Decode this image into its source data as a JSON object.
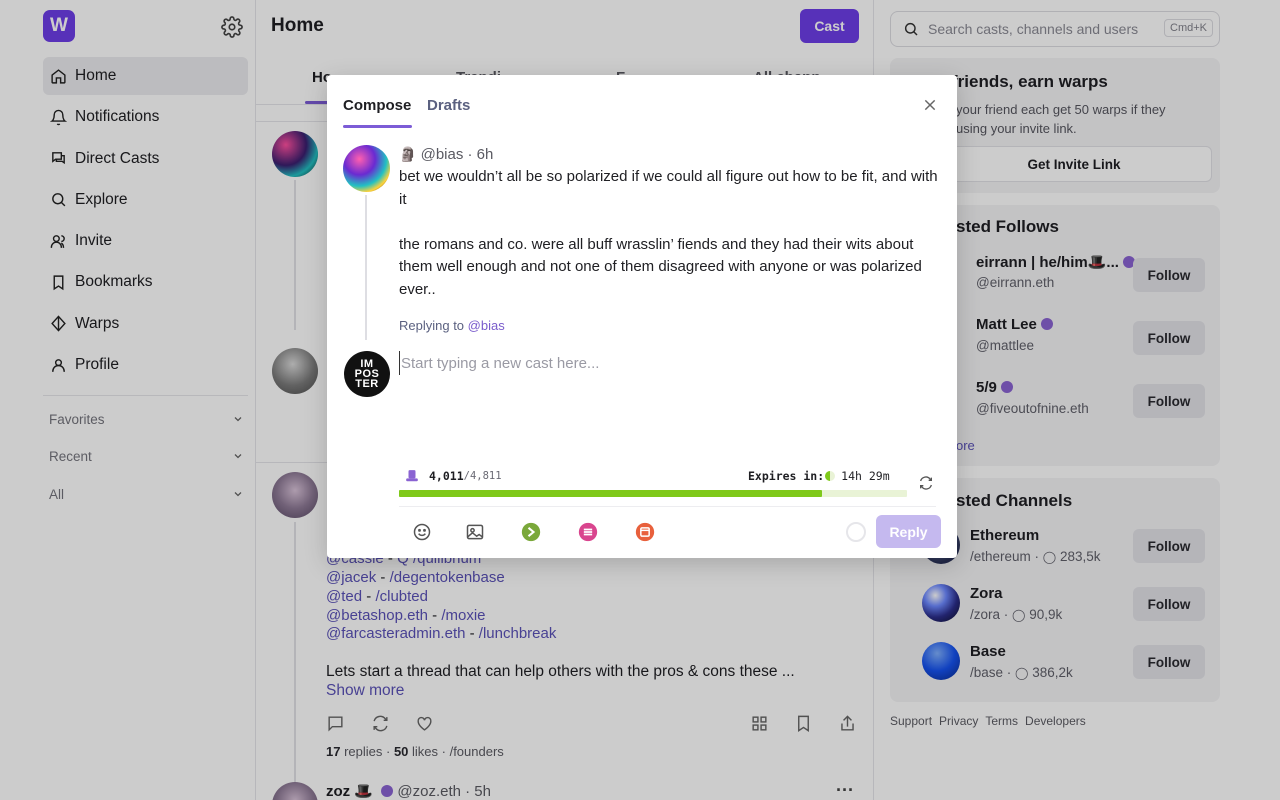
{
  "app": {
    "logo": "W"
  },
  "sidebar": {
    "items": [
      {
        "label": "Home",
        "icon": "home-icon",
        "active": true
      },
      {
        "label": "Notifications",
        "icon": "bell-icon"
      },
      {
        "label": "Direct Casts",
        "icon": "chat-icon"
      },
      {
        "label": "Explore",
        "icon": "search-icon"
      },
      {
        "label": "Invite",
        "icon": "users-icon"
      },
      {
        "label": "Bookmarks",
        "icon": "bookmark-icon"
      },
      {
        "label": "Warps",
        "icon": "warp-diamond-icon"
      },
      {
        "label": "Profile",
        "icon": "user-icon"
      }
    ],
    "sections": [
      "Favorites",
      "Recent",
      "All"
    ]
  },
  "main": {
    "title": "Home",
    "cast_button": "Cast",
    "tabs": [
      "Ho",
      "Trendi",
      "F",
      "All chann"
    ],
    "feed_links": [
      {
        "user": "@cassie",
        "sep": " - ",
        "channel": "/quilibrium",
        "prefix": "Q "
      },
      {
        "user": "@jacek",
        "sep": " - ",
        "channel": "/degentokenbase"
      },
      {
        "user": "@ted",
        "sep": " - ",
        "channel": "/clubted"
      },
      {
        "user": "@betashop.eth",
        "sep": " - ",
        "channel": "/moxie"
      },
      {
        "user": "@farcasteradmin.eth",
        "sep": " - ",
        "channel": "/lunchbreak"
      }
    ],
    "thread_text": "Lets start a thread that can help others with the pros & cons these ...",
    "show_more": "Show more",
    "meta": {
      "replies": "17",
      "replies_label": " replies · ",
      "likes": "50",
      "likes_label": " likes",
      "channel": " · /founders"
    },
    "next_cast": {
      "name": "zoz",
      "emoji": "🎩",
      "handle": "@zoz.eth · 5h",
      "more": "···"
    }
  },
  "right": {
    "search": {
      "placeholder": "Search casts, channels and users",
      "shortcut": "Cmd+K"
    },
    "invite": {
      "title": "friends, earn warps",
      "desc_line1": "your friend each get 50 warps if they",
      "desc_line2": "using your invite link.",
      "button": "Get Invite Link"
    },
    "follows": {
      "title": "sted Follows",
      "users": [
        {
          "name": "eirrann | he/him🎩...",
          "handle": "@eirrann.eth"
        },
        {
          "name": "Matt Lee",
          "handle": "@mattlee"
        },
        {
          "name": "5/9",
          "handle": "@fiveoutofnine.eth"
        }
      ],
      "follow_label": "Follow",
      "more": "ore"
    },
    "channels": {
      "title": "sted Channels",
      "items": [
        {
          "name": "Ethereum",
          "handle": "/ethereum",
          "members": "283,5k"
        },
        {
          "name": "Zora",
          "handle": "/zora",
          "members": "90,9k"
        },
        {
          "name": "Base",
          "handle": "/base",
          "members": "386,2k"
        }
      ]
    },
    "footer": [
      "Support",
      "Privacy",
      "Terms",
      "Developers"
    ]
  },
  "modal": {
    "tabs": {
      "compose": "Compose",
      "drafts": "Drafts"
    },
    "parent": {
      "author": "@bias · 6h",
      "body": "bet we wouldn’t all be so polarized if we could all figure out how to be fit, and with it\n\nthe romans and co. were all buff wrasslin’ fiends and they had their wits about them well enough and not one of them disagreed with anyone or was polarized ever.."
    },
    "replying_label": "Replying to ",
    "replying_to": "@bias",
    "avatar_text": {
      "l1": "IM",
      "l2": "POS",
      "l3": "TER"
    },
    "input": {
      "placeholder": "Start typing a new cast here...",
      "value": ""
    },
    "warps": {
      "used": "4,011",
      "total": "/4,811"
    },
    "expires": {
      "label": "Expires in: ",
      "time": "14h 29m"
    },
    "progress": 0.833,
    "reply_button": "Reply",
    "colors": {
      "accent": "#6d3ee8",
      "progress": "#7fc91a"
    }
  }
}
